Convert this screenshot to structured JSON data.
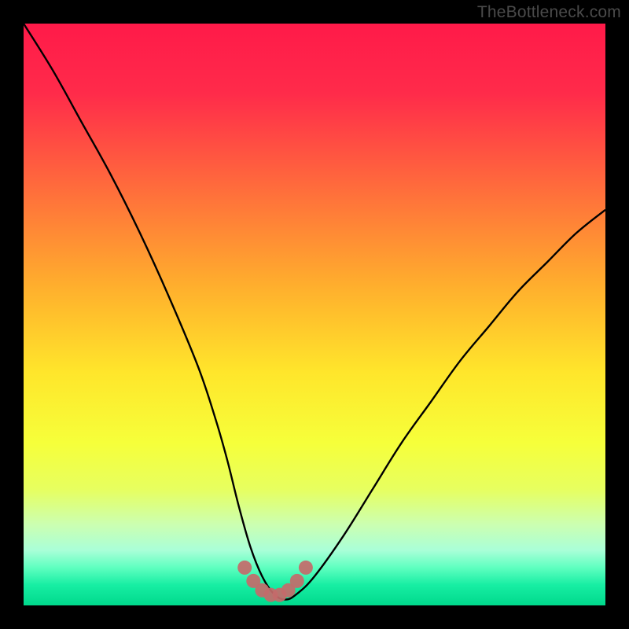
{
  "watermark": "TheBottleneck.com",
  "chart_data": {
    "type": "line",
    "title": "",
    "xlabel": "",
    "ylabel": "",
    "xlim": [
      0,
      100
    ],
    "ylim": [
      0,
      100
    ],
    "series": [
      {
        "name": "bottleneck-curve",
        "x": [
          0,
          5,
          10,
          15,
          20,
          25,
          30,
          33,
          35,
          37,
          39,
          41,
          43,
          45,
          47,
          50,
          55,
          60,
          65,
          70,
          75,
          80,
          85,
          90,
          95,
          100
        ],
        "y": [
          100,
          92,
          83,
          74,
          64,
          53,
          41,
          32,
          25,
          17,
          10,
          5,
          2,
          1,
          2,
          5,
          12,
          20,
          28,
          35,
          42,
          48,
          54,
          59,
          64,
          68
        ]
      },
      {
        "name": "optimal-range-markers",
        "x": [
          38,
          39.5,
          41,
          42.5,
          44,
          45.5,
          47,
          48.5
        ],
        "y": [
          6.5,
          4.2,
          2.6,
          1.8,
          1.8,
          2.6,
          4.2,
          6.5
        ]
      }
    ],
    "gradient_stops": [
      {
        "pos": 0.0,
        "color": "#ff1a49"
      },
      {
        "pos": 0.12,
        "color": "#ff2b4a"
      },
      {
        "pos": 0.28,
        "color": "#ff6b3c"
      },
      {
        "pos": 0.45,
        "color": "#ffae2d"
      },
      {
        "pos": 0.6,
        "color": "#ffe62b"
      },
      {
        "pos": 0.72,
        "color": "#f6ff3a"
      },
      {
        "pos": 0.8,
        "color": "#e7ff5f"
      },
      {
        "pos": 0.86,
        "color": "#ccffb0"
      },
      {
        "pos": 0.905,
        "color": "#aaffd8"
      },
      {
        "pos": 0.935,
        "color": "#5fffc0"
      },
      {
        "pos": 0.965,
        "color": "#17eea3"
      },
      {
        "pos": 1.0,
        "color": "#00d98c"
      }
    ],
    "marker_color": "#c46a6a",
    "curve_color": "#000000"
  }
}
